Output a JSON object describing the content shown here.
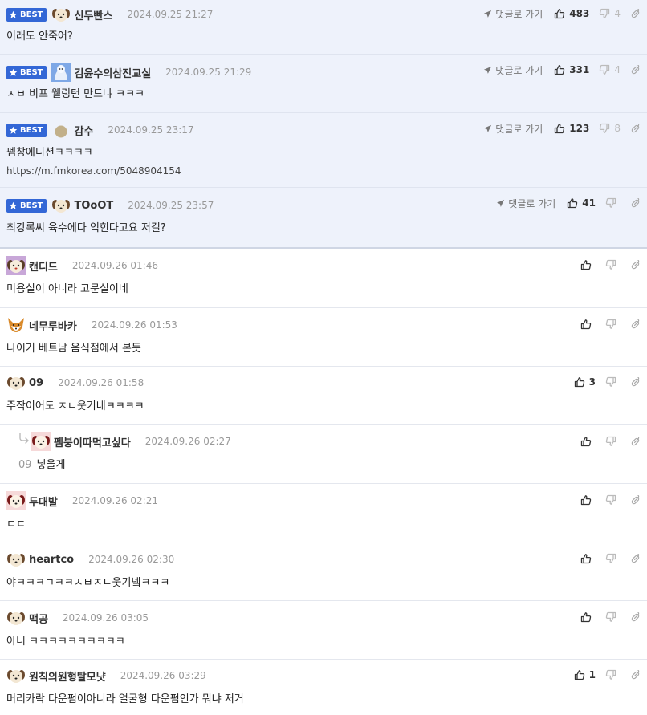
{
  "labels": {
    "best": "BEST",
    "reply": "댓글로 가기"
  },
  "comments": [
    {
      "nick": "신두빤스",
      "date": "2024.09.25 21:27",
      "text": "이래도 안죽어?",
      "up": "483",
      "down": "4"
    },
    {
      "nick": "김윤수의삼진교실",
      "date": "2024.09.25 21:29",
      "text": "ㅅㅂ 비프 웰링턴 만드냐 ㅋㅋㅋ",
      "up": "331",
      "down": "4"
    },
    {
      "nick": "감수",
      "date": "2024.09.25 23:17",
      "text": "펨창에디션ㅋㅋㅋㅋ",
      "url": "https://m.fmkorea.com/5048904154",
      "up": "123",
      "down": "8"
    },
    {
      "nick": "TOoOT",
      "date": "2024.09.25 23:57",
      "text": "최강록씨 육수에다 익힌다고요 저걸?",
      "up": "41"
    },
    {
      "nick": "캔디드",
      "date": "2024.09.26 01:46",
      "text": "미용실이 아니라 고문실이네"
    },
    {
      "nick": "네무루바카",
      "date": "2024.09.26 01:53",
      "text": "나이거 베트남 음식점에서 본듯"
    },
    {
      "nick": "09",
      "date": "2024.09.26 01:58",
      "text": "주작이어도 ㅈㄴ웃기네ㅋㅋㅋㅋ",
      "up": "3"
    },
    {
      "nick": "펨붕이따먹고싶다",
      "date": "2024.09.26 02:27",
      "parent": "09",
      "text": "넣을게"
    },
    {
      "nick": "두대발",
      "date": "2024.09.26 02:21",
      "text": "ㄷㄷ"
    },
    {
      "nick": "heartco",
      "date": "2024.09.26 02:30",
      "text": "야ㅋㅋㅋㄱㅋㅋㅅㅂㅈㄴ웃기넼ㅋㅋㅋ"
    },
    {
      "nick": "맥공",
      "date": "2024.09.26 03:05",
      "text": "아니 ㅋㅋㅋㅋㅋㅋㅋㅋㅋㅋ"
    },
    {
      "nick": "원칙의원형탈모냣",
      "date": "2024.09.26 03:29",
      "text": "머리카락 다운펌이아니라 얼굴형 다운펌인가 뭐냐 저거",
      "up": "1"
    }
  ],
  "colors": {
    "best_bg": "#eef2fb",
    "badge": "#3367d6"
  }
}
